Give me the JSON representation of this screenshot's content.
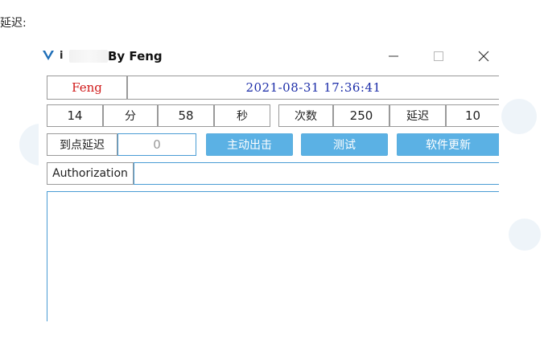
{
  "page": {
    "top_text": "延迟:"
  },
  "window": {
    "title_prefix": "i",
    "title": "By Feng",
    "logo_icon": "v-logo-icon",
    "accent_color": "#1f6fb8"
  },
  "row1": {
    "name": "Feng",
    "datetime": "2021-08-31 17:36:41",
    "name_color": "#d01919",
    "datetime_color": "#1b2ca8"
  },
  "row2": {
    "minute_value": "14",
    "minute_label": "分",
    "second_value": "58",
    "second_label": "秒",
    "count_label": "次数",
    "count_value": "250",
    "delay_label": "延迟",
    "delay_value": "10"
  },
  "row3": {
    "arrival_delay_label": "到点延迟",
    "arrival_delay_value": "0",
    "active_button": "主动出击",
    "test_button": "测试",
    "update_button": "软件更新",
    "button_color": "#5bb1e4"
  },
  "row4": {
    "auth_label": "Authorization",
    "auth_value": ""
  },
  "log": {
    "content": ""
  }
}
